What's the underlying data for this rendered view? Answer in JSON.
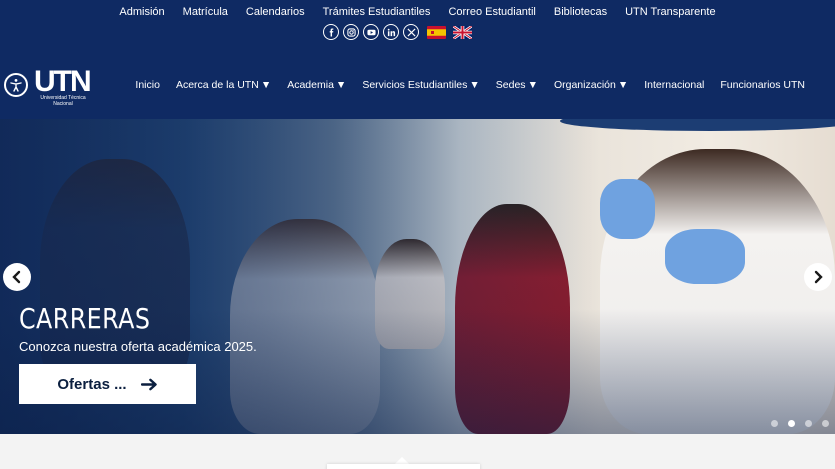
{
  "top_links": [
    "Admisión",
    "Matrícula",
    "Calendarios",
    "Trámites Estudiantiles",
    "Correo Estudiantil",
    "Bibliotecas",
    "UTN Transparente"
  ],
  "social_icons": [
    "facebook-icon",
    "instagram-icon",
    "youtube-icon",
    "linkedin-icon",
    "x-icon"
  ],
  "languages": [
    "spanish-flag",
    "english-flag"
  ],
  "logo": {
    "text": "UTN",
    "subtitle": "Universidad Técnica Nacional"
  },
  "main_nav": [
    {
      "label": "Inicio",
      "dropdown": false
    },
    {
      "label": "Acerca de la UTN",
      "dropdown": true
    },
    {
      "label": "Academia",
      "dropdown": true
    },
    {
      "label": "Servicios Estudiantiles",
      "dropdown": true
    },
    {
      "label": "Sedes",
      "dropdown": true
    },
    {
      "label": "Organización",
      "dropdown": true
    },
    {
      "label": "Internacional",
      "dropdown": false
    },
    {
      "label": "Funcionarios UTN",
      "dropdown": false
    }
  ],
  "hero": {
    "title": "CARRERAS",
    "subtitle": "Conozca nuestra oferta académica 2025.",
    "button_label": "Ofertas ...",
    "slide_count": 4,
    "active_slide": 2
  },
  "colors": {
    "header_bg": "#0f2a63",
    "caret": "#e8a23a",
    "button_text": "#0b1f3f"
  }
}
